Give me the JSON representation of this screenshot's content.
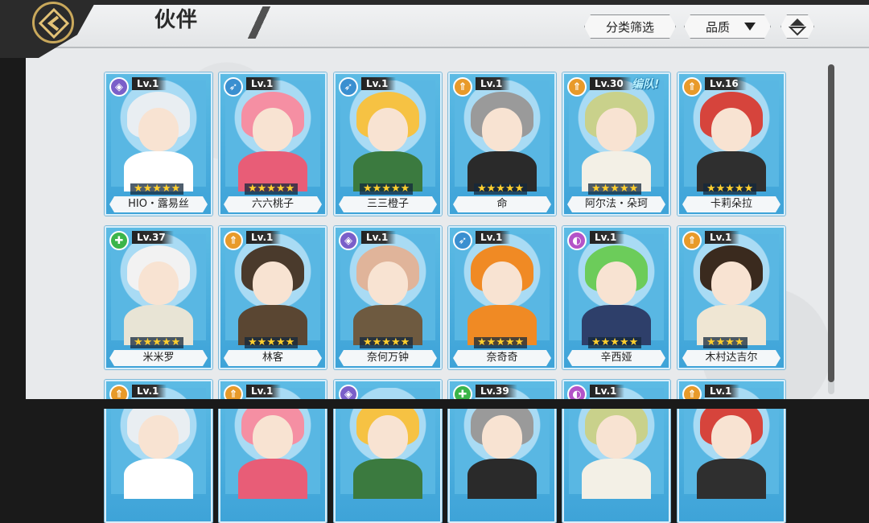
{
  "header": {
    "title": "伙伴",
    "filter_label": "分类筛选",
    "sort_label": "品质",
    "sort_icon": "triangle-down",
    "order_icon": "up-down-arrows"
  },
  "colors": {
    "card_blue": "#4eb1e0",
    "star": "#ffcf2e",
    "role_defense": "#7a5fc9",
    "role_ranged": "#3a8fd0",
    "role_attack": "#e89a2a",
    "role_support": "#3bb54a",
    "role_magic": "#b453c8"
  },
  "row1": [
    {
      "role": "defense",
      "role_icon": "shield-icon",
      "level": "Lv.1",
      "stars": "★★★★★",
      "name": "HIO・露易丝",
      "tag": ""
    },
    {
      "role": "ranged",
      "role_icon": "bow-icon",
      "level": "Lv.1",
      "stars": "★★★★★",
      "name": "六六桃子",
      "tag": ""
    },
    {
      "role": "ranged",
      "role_icon": "bow-icon",
      "level": "Lv.1",
      "stars": "★★★★★",
      "name": "三三橙子",
      "tag": ""
    },
    {
      "role": "attack",
      "role_icon": "blade-icon",
      "level": "Lv.1",
      "stars": "★★★★★",
      "name": "命",
      "tag": ""
    },
    {
      "role": "attack",
      "role_icon": "blade-icon",
      "level": "Lv.30",
      "stars": "★★★★★",
      "name": "阿尔法・朵珂",
      "tag": "编队!"
    },
    {
      "role": "attack",
      "role_icon": "blade-icon",
      "level": "Lv.16",
      "stars": "★★★★★",
      "name": "卡莉朵拉",
      "tag": ""
    }
  ],
  "row2": [
    {
      "role": "support",
      "role_icon": "cross-icon",
      "level": "Lv.37",
      "stars": "★★★★★",
      "name": "米米罗",
      "tag": ""
    },
    {
      "role": "attack",
      "role_icon": "blade-icon",
      "level": "Lv.1",
      "stars": "★★★★★",
      "name": "林客",
      "tag": ""
    },
    {
      "role": "defense",
      "role_icon": "shield-icon",
      "level": "Lv.1",
      "stars": "★★★★★",
      "name": "奈何万钟",
      "tag": ""
    },
    {
      "role": "ranged",
      "role_icon": "bow-icon",
      "level": "Lv.1",
      "stars": "★★★★★",
      "name": "奈奇奇",
      "tag": ""
    },
    {
      "role": "magic",
      "role_icon": "orb-icon",
      "level": "Lv.1",
      "stars": "★★★★★",
      "name": "辛西娅",
      "tag": ""
    },
    {
      "role": "attack",
      "role_icon": "blade-icon",
      "level": "Lv.1",
      "stars": "★★★★",
      "name": "木村达吉尔",
      "tag": ""
    }
  ],
  "row3": [
    {
      "role": "attack",
      "role_icon": "blade-icon",
      "level": "Lv.1"
    },
    {
      "role": "attack",
      "role_icon": "blade-icon",
      "level": "Lv.1"
    },
    {
      "role": "defense",
      "role_icon": "shield-icon",
      "level": ""
    },
    {
      "role": "support",
      "role_icon": "cross-icon",
      "level": "Lv.39"
    },
    {
      "role": "magic",
      "role_icon": "orb-icon",
      "level": "Lv.1"
    },
    {
      "role": "attack",
      "role_icon": "blade-icon",
      "level": "Lv.1"
    }
  ]
}
